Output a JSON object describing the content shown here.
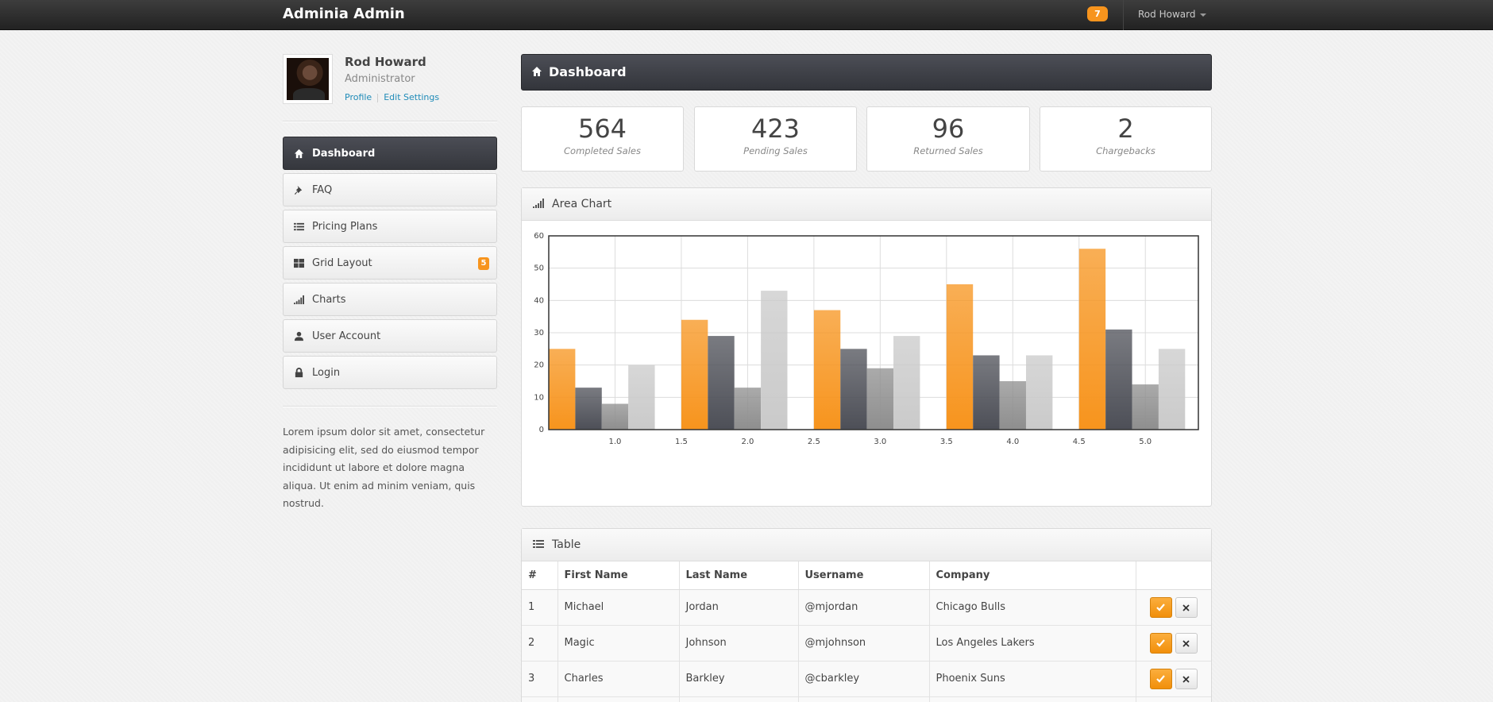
{
  "app": {
    "title": "Adminia Admin",
    "notification_count": "7",
    "user_menu_label": "Rod Howard"
  },
  "profile": {
    "name": "Rod Howard",
    "role": "Administrator",
    "links": [
      "Profile",
      "Edit Settings"
    ]
  },
  "sidebar": {
    "items": [
      {
        "label": "Dashboard",
        "icon": "home-icon",
        "active": true
      },
      {
        "label": "FAQ",
        "icon": "pushpin-icon"
      },
      {
        "label": "Pricing Plans",
        "icon": "list-icon"
      },
      {
        "label": "Grid Layout",
        "icon": "grid-icon",
        "badge": "5"
      },
      {
        "label": "Charts",
        "icon": "signal-icon"
      },
      {
        "label": "User Account",
        "icon": "user-icon"
      },
      {
        "label": "Login",
        "icon": "lock-icon"
      }
    ],
    "blurb": "Lorem ipsum dolor sit amet, consectetur adipisicing elit, sed do eiusmod tempor incididunt ut labore et dolore magna aliqua. Ut enim ad minim veniam, quis nostrud."
  },
  "main": {
    "title": "Dashboard",
    "stats": [
      {
        "value": "564",
        "label": "Completed Sales"
      },
      {
        "value": "423",
        "label": "Pending Sales"
      },
      {
        "value": "96",
        "label": "Returned Sales"
      },
      {
        "value": "2",
        "label": "Chargebacks"
      }
    ],
    "chart_panel_title": "Area Chart",
    "table_panel_title": "Table",
    "table": {
      "headers": [
        "#",
        "First Name",
        "Last Name",
        "Username",
        "Company",
        ""
      ],
      "rows": [
        [
          "1",
          "Michael",
          "Jordan",
          "@mjordan",
          "Chicago Bulls"
        ],
        [
          "2",
          "Magic",
          "Johnson",
          "@mjohnson",
          "Los Angeles Lakers"
        ],
        [
          "3",
          "Charles",
          "Barkley",
          "@cbarkley",
          "Phoenix Suns"
        ]
      ]
    }
  },
  "colors": {
    "accent": "#f7941d",
    "dark": "#3b3d44",
    "mid": "#8a8a8a",
    "light": "#c8c8c8"
  },
  "chart_data": {
    "type": "bar",
    "x_ticks": [
      1.0,
      1.5,
      2.0,
      2.5,
      3.0,
      3.5,
      4.0,
      4.5,
      5.0
    ],
    "x_tick_labels": [
      "1.0",
      "1.5",
      "2.0",
      "2.5",
      "3.0",
      "3.5",
      "4.0",
      "4.5",
      "5.0"
    ],
    "xlim": [
      0.5,
      5.4
    ],
    "ylim": [
      0,
      60
    ],
    "y_ticks": [
      0,
      10,
      20,
      30,
      40,
      50,
      60
    ],
    "groups": [
      0.5,
      1.5,
      2.5,
      3.5,
      4.5
    ],
    "bar_width": 0.2,
    "series": [
      {
        "values": [
          25,
          34,
          37,
          45,
          56
        ],
        "color": "#f7941d"
      },
      {
        "values": [
          13,
          29,
          25,
          23,
          31
        ],
        "color": "#4d4f57"
      },
      {
        "values": [
          8,
          13,
          19,
          15,
          14
        ],
        "color": "#8e8e8e"
      },
      {
        "values": [
          20,
          43,
          29,
          23,
          25
        ],
        "color": "#cacaca"
      }
    ],
    "grid": true
  }
}
